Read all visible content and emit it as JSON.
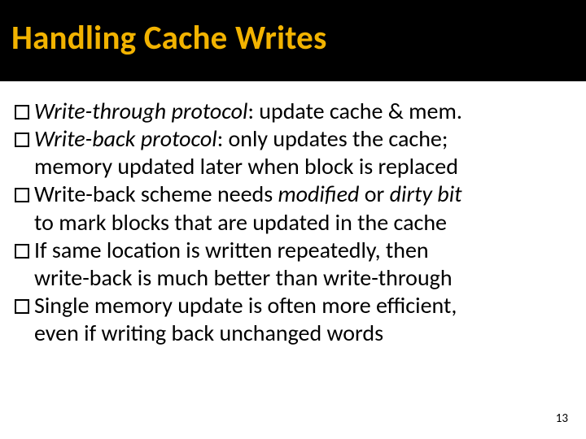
{
  "title": "Handling Cache Writes",
  "bullets": {
    "b1": {
      "em": "Write-through protocol",
      "rest": ": update cache & mem."
    },
    "b2": {
      "em": "Write-back protocol",
      "rest": ": only updates the cache;",
      "cont": "memory updated later when block is replaced"
    },
    "b3": {
      "pre": "Write-back scheme needs ",
      "em1": "modified",
      "mid": " or ",
      "em2": "dirty bit",
      "cont": "to mark blocks that are updated in the cache"
    },
    "b4": {
      "line": "If same location is written repeatedly, then",
      "cont": "write-back is much better than write-through"
    },
    "b5": {
      "line": "Single memory update is often more efficient,",
      "cont": "even if writing back unchanged words"
    }
  },
  "page_number": "13"
}
